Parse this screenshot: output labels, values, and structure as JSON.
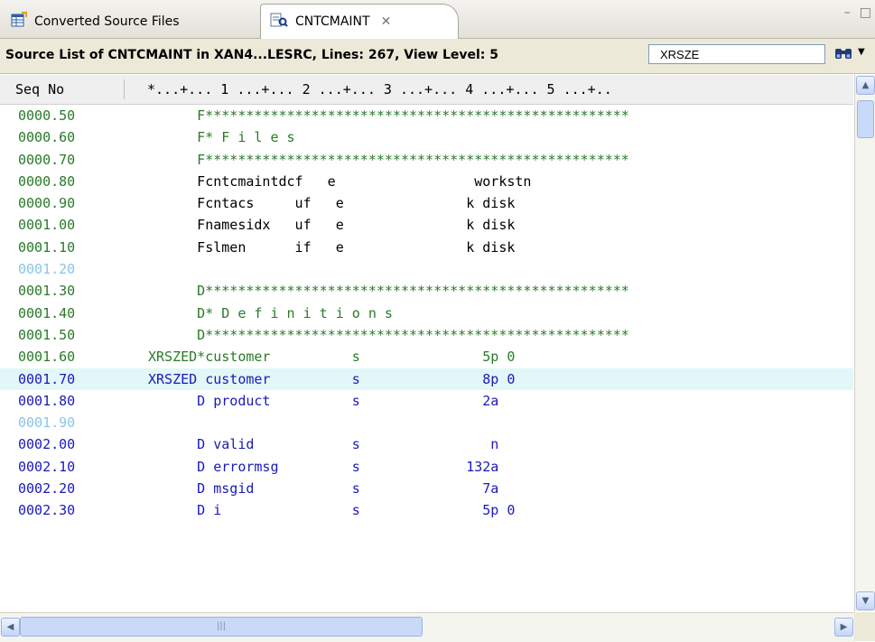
{
  "tabs": [
    {
      "label": "Converted Source Files",
      "icon": "table-icon",
      "active": false
    },
    {
      "label": "CNTCMAINT",
      "icon": "source-file-icon",
      "active": true,
      "close": "✕"
    }
  ],
  "view_controls": {
    "minimize": "–",
    "maximize": "□"
  },
  "header": {
    "title": "Source List of CNTCMAINT in XAN4...LESRC, Lines: 267, View Level: 5",
    "search_value": "XRSZE",
    "find_icon": "binoculars-icon"
  },
  "ruler": {
    "seq_label": "Seq No",
    "columns": "*...+... 1 ...+... 2 ...+... 3 ...+... 4 ...+... 5 ...+.."
  },
  "colors": {
    "green": "#2a7a2a",
    "black": "#000000",
    "blue": "#1a1ab8",
    "faint": "#8ac4e6",
    "highlight": "#e2f7f7"
  },
  "lines": [
    {
      "seq": "0000.50",
      "code": "      F****************************************************",
      "color": "green"
    },
    {
      "seq": "0000.60",
      "code": "      F* F i l e s",
      "color": "green"
    },
    {
      "seq": "0000.70",
      "code": "      F****************************************************",
      "color": "green"
    },
    {
      "seq": "0000.80",
      "code": "      Fcntcmaintdcf   e                 workstn",
      "color": "black"
    },
    {
      "seq": "0000.90",
      "code": "      Fcntacs     uf   e               k disk",
      "color": "black"
    },
    {
      "seq": "0001.00",
      "code": "      Fnamesidx   uf   e               k disk",
      "color": "black"
    },
    {
      "seq": "0001.10",
      "code": "      Fslmen      if   e               k disk",
      "color": "black"
    },
    {
      "seq": "0001.20",
      "code": "",
      "color": "faint"
    },
    {
      "seq": "0001.30",
      "code": "      D****************************************************",
      "color": "green"
    },
    {
      "seq": "0001.40",
      "code": "      D* D e f i n i t i o n s",
      "color": "green"
    },
    {
      "seq": "0001.50",
      "code": "      D****************************************************",
      "color": "green"
    },
    {
      "seq": "0001.60",
      "code": "XRSZED*customer          s               5p 0",
      "color": "green"
    },
    {
      "seq": "0001.70",
      "code": "XRSZED customer          s               8p 0",
      "color": "blue",
      "highlight": true
    },
    {
      "seq": "0001.80",
      "code": "      D product          s               2a",
      "color": "blue"
    },
    {
      "seq": "0001.90",
      "code": "",
      "color": "faint"
    },
    {
      "seq": "0002.00",
      "code": "      D valid            s                n",
      "color": "blue"
    },
    {
      "seq": "0002.10",
      "code": "      D errormsg         s             132a",
      "color": "blue"
    },
    {
      "seq": "0002.20",
      "code": "      D msgid            s               7a",
      "color": "blue"
    },
    {
      "seq": "0002.30",
      "code": "      D i                s               5p 0",
      "color": "blue"
    }
  ]
}
